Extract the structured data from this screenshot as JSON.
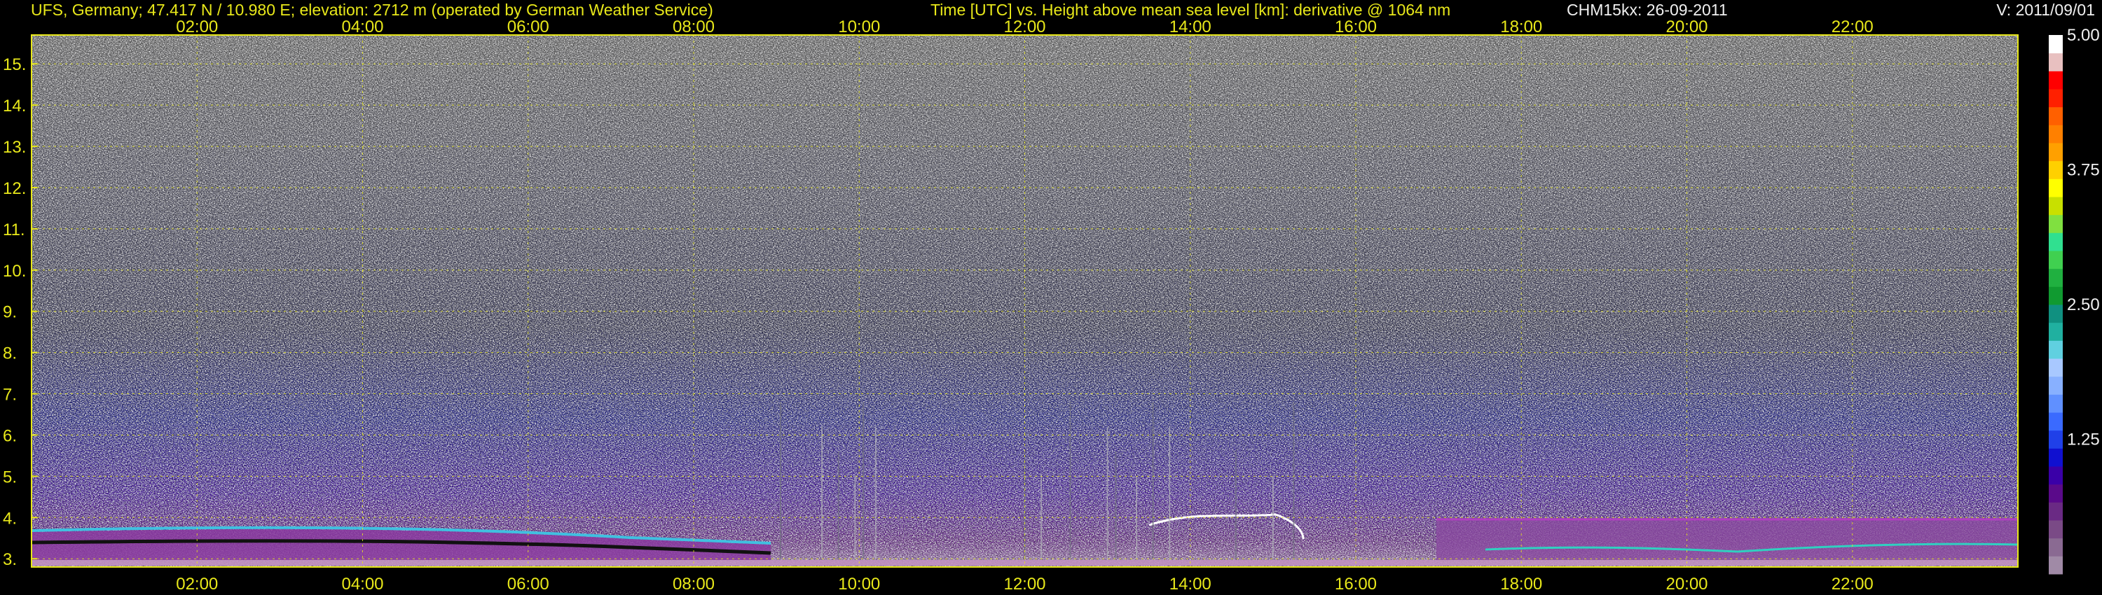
{
  "header": {
    "station": "UFS, Germany; 47.417 N / 10.980 E; elevation: 2712 m  (operated by German Weather Service)",
    "description": "Time [UTC] vs. Height above mean sea level [km]: derivative @ 1064 nm",
    "instrument_date": "CHM15kx: 26-09-2011",
    "version": "V: 2011/09/01"
  },
  "chart_data": {
    "type": "heatmap",
    "title": "Time [UTC] vs. Height above mean sea level [km]: derivative @ 1064 nm",
    "xlabel": "Time [UTC]",
    "ylabel": "Height above mean sea level [km]",
    "x_ticks": [
      "02:00",
      "04:00",
      "06:00",
      "08:00",
      "10:00",
      "12:00",
      "14:00",
      "16:00",
      "18:00",
      "20:00",
      "22:00"
    ],
    "x_tick_hours": [
      2,
      4,
      6,
      8,
      10,
      12,
      14,
      16,
      18,
      20,
      22
    ],
    "x_range_hours": [
      0,
      24
    ],
    "y_ticks": [
      "3.",
      "4.",
      "5.",
      "6.",
      "7.",
      "8.",
      "9.",
      "10.",
      "11.",
      "12.",
      "13.",
      "14.",
      "15."
    ],
    "y_tick_values": [
      3,
      4,
      5,
      6,
      7,
      8,
      9,
      10,
      11,
      12,
      13,
      14,
      15
    ],
    "y_range_km": [
      2.8,
      15.7
    ],
    "grid": true,
    "colorbar": {
      "range": [
        0,
        5.0
      ],
      "tick_labels": [
        "5.00",
        "3.75",
        "2.50",
        "1.25"
      ],
      "tick_values": [
        5.0,
        3.75,
        2.5,
        1.25
      ],
      "colors": [
        "#a08aa6",
        "#8a6a92",
        "#7a4a86",
        "#6a2a84",
        "#5a0a8a",
        "#3a00a8",
        "#1010d0",
        "#2040e8",
        "#3a6aff",
        "#6090ff",
        "#88b0ff",
        "#a8c8ff",
        "#60d0e0",
        "#20b0a0",
        "#109080",
        "#109a30",
        "#20b040",
        "#40d050",
        "#30e090",
        "#80e040",
        "#c8e000",
        "#ffff00",
        "#ffd000",
        "#ffa000",
        "#ff8000",
        "#ff6000",
        "#ff2000",
        "#ff0000",
        "#e8c0c0",
        "#ffffff"
      ]
    },
    "colors": {
      "axis": "#e8e81a",
      "background": "#000000",
      "boundary_layer": "#7a4a8a"
    }
  }
}
